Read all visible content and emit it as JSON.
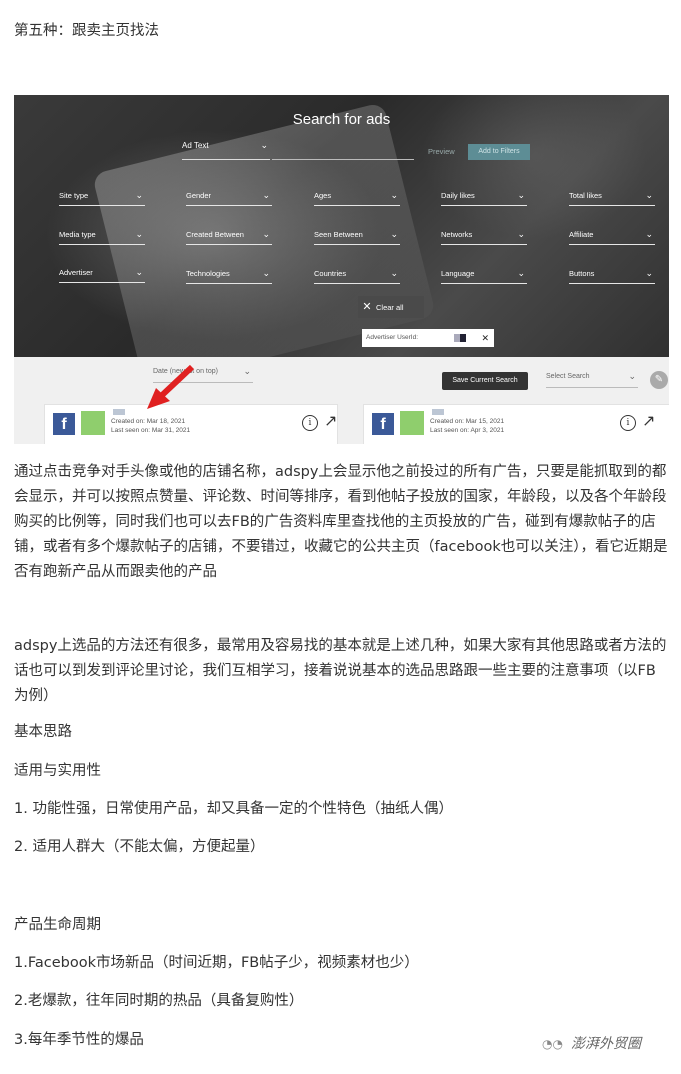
{
  "heading": "第五种：跟卖主页找法",
  "screenshot": {
    "title": "Search for ads",
    "ad_text_label": "Ad Text",
    "preview_label": "Preview",
    "add_filters_label": "Add to Filters",
    "filters": [
      "Site type",
      "Gender",
      "Ages",
      "Daily likes",
      "Total likes",
      "Media type",
      "Created Between",
      "Seen Between",
      "Networks",
      "Affiliate",
      "Advertiser",
      "Technologies",
      "Countries",
      "Language",
      "Buttons"
    ],
    "clear_all_label": "Clear all",
    "advertiser_tag": "Advertiser UserId:",
    "sort_label": "Date (newest on top)",
    "save_search_label": "Save Current Search",
    "select_search_placeholder": "Select Search",
    "cards": [
      {
        "created": "Created on: Mar 18, 2021",
        "last_seen": "Last seen on: Mar 31, 2021"
      },
      {
        "created": "Created on: Mar 15, 2021",
        "last_seen": "Last seen on: Apr 3, 2021"
      }
    ],
    "arrow_color": "#e02020"
  },
  "paragraphs": {
    "p1": "通过点击竞争对手头像或他的店铺名称，adspy上会显示他之前投过的所有广告，只要是能抓取到的都会显示，并可以按照点赞量、评论数、时间等排序，看到他帖子投放的国家，年龄段，以及各个年龄段购买的比例等，同时我们也可以去FB的广告资料库里查找他的主页投放的广告，碰到有爆款帖子的店铺，或者有多个爆款帖子的店铺，不要错过，收藏它的公共主页（facebook也可以关注），看它近期是否有跑新产品从而跟卖他的产品",
    "p2": "adspy上选品的方法还有很多，最常用及容易找的基本就是上述几种，如果大家有其他思路或者方法的话也可以到发到评论里讨论，我们互相学习，接着说说基本的选品思路跟一些主要的注意事项（以FB为例）",
    "basic": "基本思路",
    "applicability": "适用与实用性",
    "item1": "1. 功能性强，日常使用产品，却又具备一定的个性特色（抽纸人偶）",
    "item2": "2. 适用人群大（不能太偏，方便起量）",
    "lifecycle": "产品生命周期",
    "life1": "1.Facebook市场新品（时间近期，FB帖子少，视频素材也少）",
    "life2": "2.老爆款，往年同时期的热品（具备复购性）",
    "life3": "3.每年季节性的爆品"
  },
  "watermark": "澎湃外贸圈"
}
